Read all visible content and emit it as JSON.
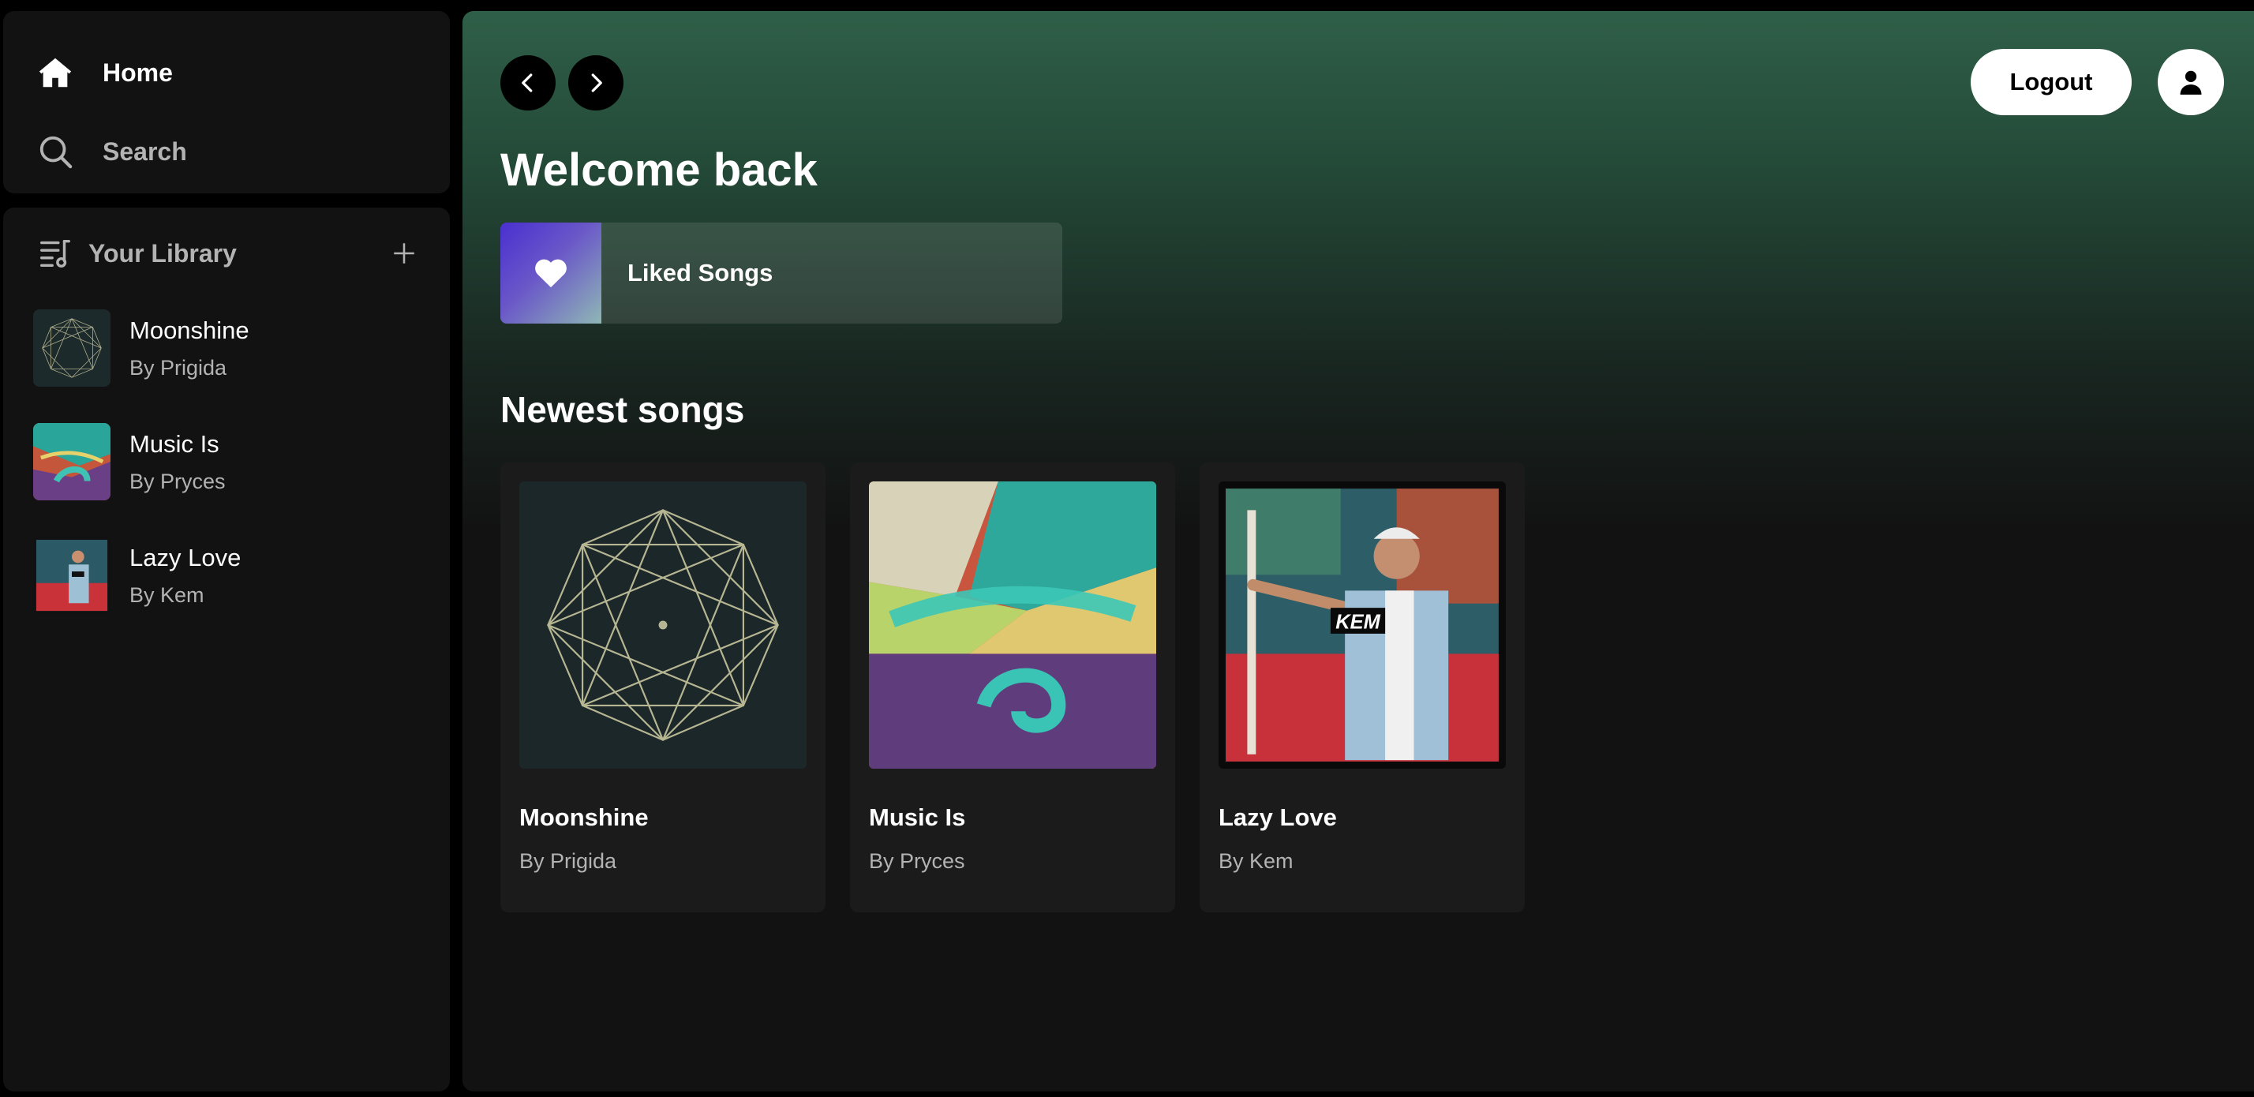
{
  "sidebar": {
    "nav": [
      {
        "label": "Home",
        "icon": "home-icon"
      },
      {
        "label": "Search",
        "icon": "search-icon"
      }
    ],
    "library": {
      "title": "Your Library",
      "items": [
        {
          "title": "Moonshine",
          "subtitle": "By Prigida"
        },
        {
          "title": "Music Is",
          "subtitle": "By Pryces"
        },
        {
          "title": "Lazy Love",
          "subtitle": "By Kem"
        }
      ]
    }
  },
  "header": {
    "logout_label": "Logout"
  },
  "main": {
    "welcome": "Welcome back",
    "liked_songs_label": "Liked Songs",
    "section_title": "Newest songs",
    "songs": [
      {
        "title": "Moonshine",
        "subtitle": "By Prigida"
      },
      {
        "title": "Music Is",
        "subtitle": "By Pryces"
      },
      {
        "title": "Lazy Love",
        "subtitle": "By Kem",
        "art_text": "KEM"
      }
    ]
  },
  "colors": {
    "background": "#121212",
    "header_gradient": "#2f5f48",
    "muted_text": "#b3b3b3"
  }
}
